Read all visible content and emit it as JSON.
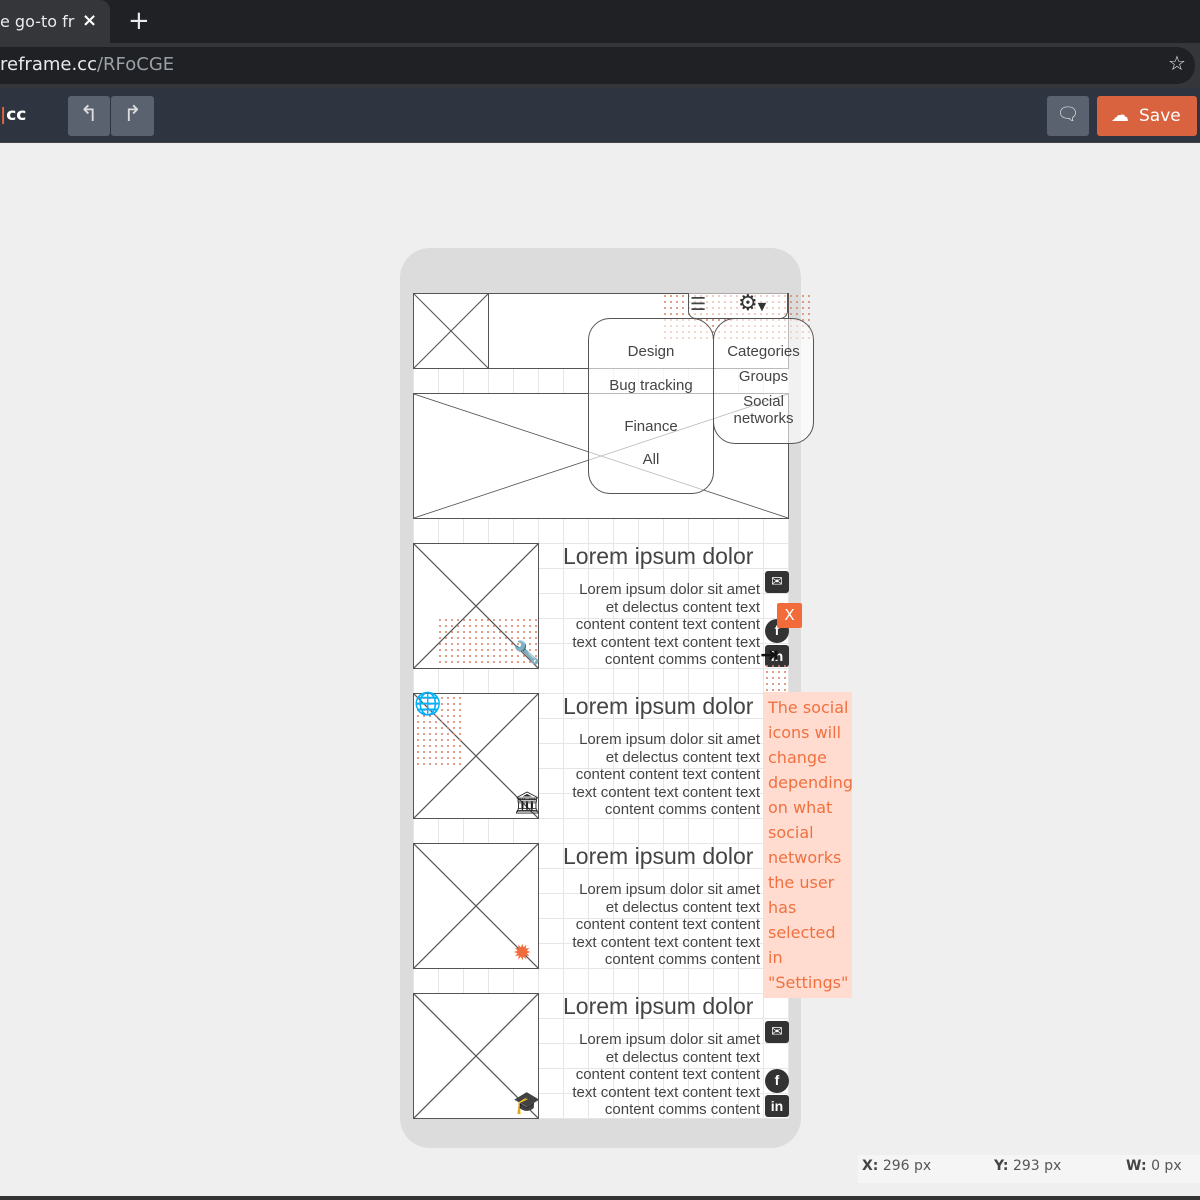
{
  "browser": {
    "tab_title": "e go-to fr",
    "tab_close": "×",
    "new_tab": "+",
    "url_host": "reframe.cc",
    "url_path": "/RFoCGE",
    "star": "☆"
  },
  "toolbar": {
    "logo": "cc",
    "undo": "↰",
    "redo": "↱",
    "comment": "🗨",
    "save_label": "Save",
    "save_icon": "☁"
  },
  "phone": {
    "menu_left": [
      "Design",
      "Bug tracking",
      "Finance",
      "All"
    ],
    "menu_right": [
      "Categories",
      "Groups",
      "Social networks"
    ],
    "cards": [
      {
        "title": "Lorem ipsum dolor",
        "lines": [
          "Lorem ipsum dolor sit amet",
          "et delectus content text",
          "content content text content",
          "text content text content text",
          "content comms content"
        ],
        "badge": "wrench-icon"
      },
      {
        "title": "Lorem ipsum dolor",
        "lines": [
          "Lorem ipsum dolor sit amet",
          "et delectus content text",
          "content content text content",
          "text content text content text",
          "content comms content"
        ],
        "badge": "bank-icon"
      },
      {
        "title": "Lorem ipsum dolor",
        "lines": [
          "Lorem ipsum dolor sit amet",
          "et delectus content text",
          "content content text content",
          "text content text content text",
          "content comms content"
        ],
        "badge": "bug-icon"
      },
      {
        "title": "Lorem ipsum dolor",
        "lines": [
          "Lorem ipsum dolor sit amet",
          "et delectus content text",
          "content content text content",
          "text content text content text",
          "content comms content"
        ],
        "badge": "graduation-cap-icon"
      }
    ],
    "close_label": "X",
    "note": "The social icons will change depending on what social networks the user has selected in \"Settings\""
  },
  "status": {
    "x_label": "X:",
    "x_value": "296 px",
    "y_label": "Y:",
    "y_value": "293 px",
    "w_label": "W:",
    "w_value": "0 px"
  },
  "colors": {
    "accent": "#d9623f",
    "note_bg": "#ffdccf",
    "note_text": "#f07040"
  }
}
